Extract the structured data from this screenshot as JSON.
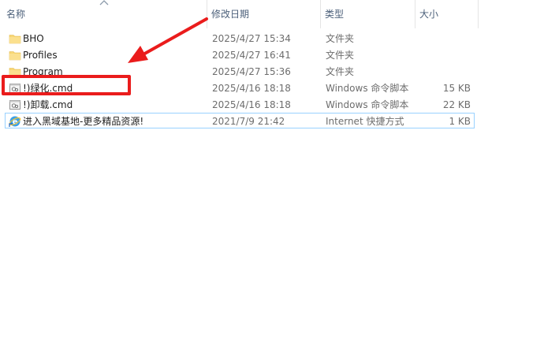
{
  "columns": {
    "name": "名称",
    "date": "修改日期",
    "type": "类型",
    "size": "大小"
  },
  "files": [
    {
      "name": "BHO",
      "date": "2025/4/27 15:34",
      "type": "文件夹",
      "size": "",
      "icon": "folder-icon"
    },
    {
      "name": "Profiles",
      "date": "2025/4/27 16:41",
      "type": "文件夹",
      "size": "",
      "icon": "folder-icon"
    },
    {
      "name": "Program",
      "date": "2025/4/27 15:36",
      "type": "文件夹",
      "size": "",
      "icon": "folder-icon"
    },
    {
      "name": "!)绿化.cmd",
      "date": "2025/4/16 18:18",
      "type": "Windows 命令脚本",
      "size": "15 KB",
      "icon": "cmd-script-icon"
    },
    {
      "name": "!)卸载.cmd",
      "date": "2025/4/16 18:18",
      "type": "Windows 命令脚本",
      "size": "22 KB",
      "icon": "cmd-script-icon"
    },
    {
      "name": "进入黑域基地-更多精品资源!",
      "date": "2021/7/9 21:42",
      "type": "Internet 快捷方式",
      "size": "1 KB",
      "icon": "internet-shortcut-icon"
    }
  ],
  "colors": {
    "annotation": "#ea1c1c",
    "hover_border": "#99d1ff",
    "folder": "#f8d775"
  }
}
